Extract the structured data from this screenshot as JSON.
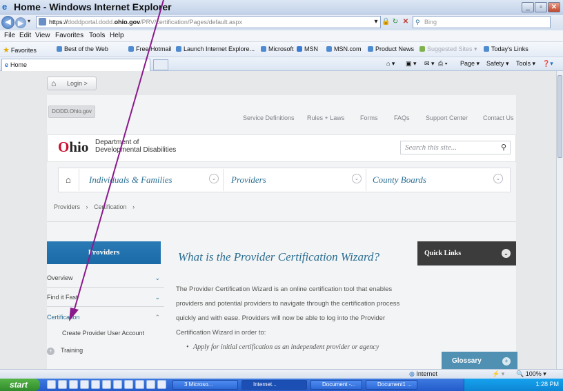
{
  "window": {
    "title": "Home - Windows Internet Explorer"
  },
  "address": {
    "scheme": "https://",
    "host_prefix": "doddportal.dodd.",
    "host_bold": "ohio.gov",
    "path": "/PRV/certification/Pages/default.aspx",
    "search_placeholder": "Bing"
  },
  "menu": [
    "File",
    "Edit",
    "View",
    "Favorites",
    "Tools",
    "Help"
  ],
  "favorites": {
    "label": "Favorites",
    "items": [
      "Best of the Web",
      "Free Hotmail",
      "Launch Internet Explore...",
      "Microsoft",
      "MSN",
      "MSN.com",
      "Product News",
      "Suggested Sites",
      "Today's Links"
    ]
  },
  "tab": {
    "label": "Home"
  },
  "commands": [
    "Page",
    "Safety",
    "Tools"
  ],
  "site": {
    "login": "Login",
    "dodd_tag": "DODD.Ohio.gov",
    "util_nav": [
      "Service Definitions",
      "Rules + Laws",
      "Forms",
      "FAQs",
      "Support Center",
      "Contact Us"
    ],
    "logo": {
      "o": "O",
      "hio": "hio",
      "dept_line1": "Department of",
      "dept_line2": "Developmental Disabilities"
    },
    "search_placeholder": "Search this site...",
    "main_nav": [
      "Individuals & Families",
      "Providers",
      "County Boards"
    ],
    "breadcrumb": [
      "Providers",
      "Certification"
    ],
    "sidebar": {
      "title": "Providers",
      "items": [
        "Overview",
        "Find it Fast",
        "Certification"
      ],
      "subitem": "Create Provider User Account",
      "training": "Training"
    },
    "heading": "What is the Provider Certification Wizard?",
    "paragraph": "The Provider Certification Wizard is an online certification tool that enables providers and potential providers to navigate through the certification process quickly and with ease.  Providers will now be able to log into the Provider Certification Wizard in order to:",
    "bullet": "Apply for initial certification as an independent provider or agency",
    "quick_links": "Quick Links",
    "glossary": "Glossary"
  },
  "status": {
    "zone": "Internet",
    "zoom": "100%"
  },
  "taskbar": {
    "start": "start",
    "items": [
      "3 Microso...",
      "Internet...",
      "Document -...",
      "Document1 ..."
    ],
    "clock": "1:28 PM"
  },
  "colors": {
    "annotation_arrow": "#8a1a8c",
    "brand_blue": "#2b6e92",
    "ohio_red": "#c8102e"
  }
}
